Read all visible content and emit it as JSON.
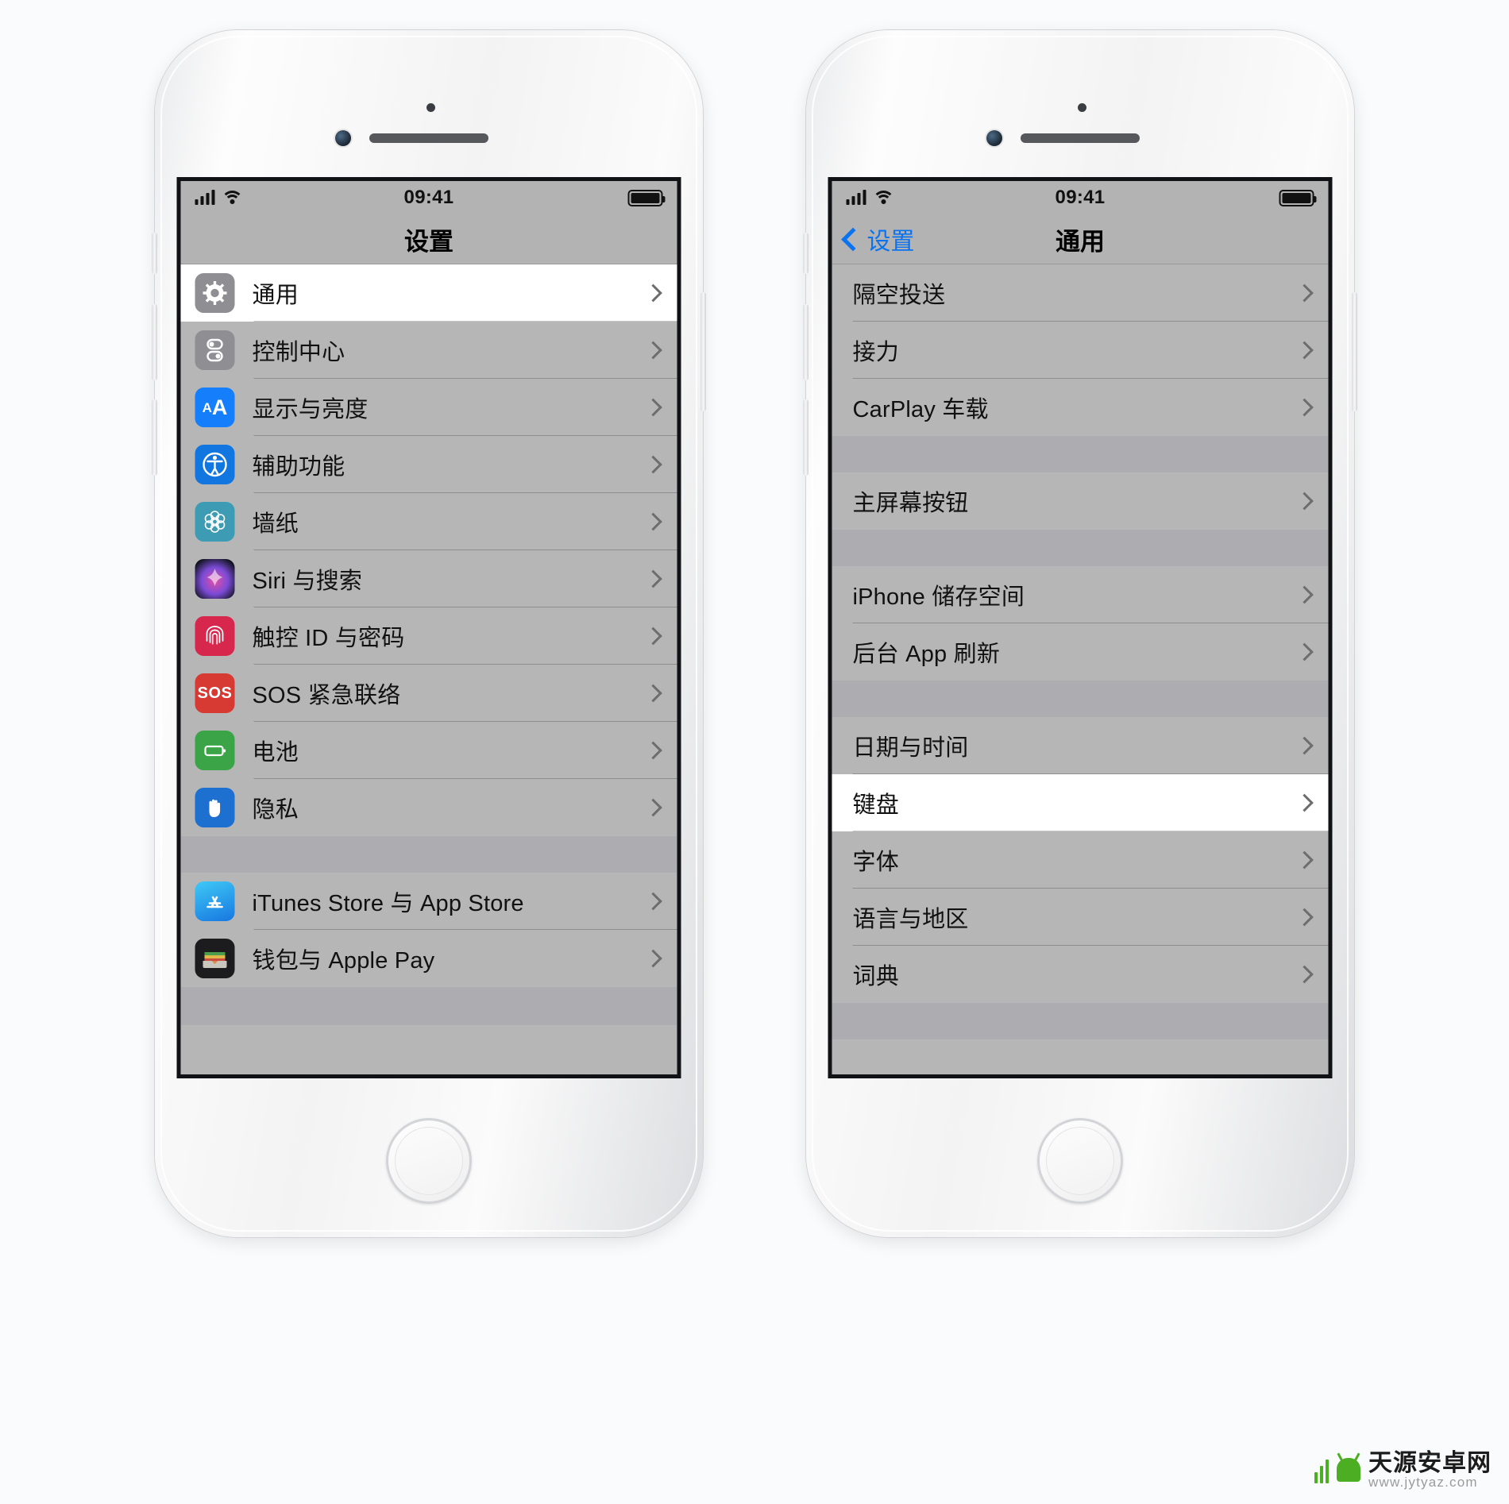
{
  "left_phone": {
    "status_bar": {
      "signal_icon": "cellular-bars-icon",
      "wifi_icon": "wifi-icon",
      "time": "09:41",
      "battery_icon": "battery-full-icon"
    },
    "nav": {
      "title": "设置"
    },
    "groups": [
      {
        "rows": [
          {
            "icon": "gear-icon",
            "label": "通用",
            "selected": true
          },
          {
            "icon": "control-center-icon",
            "label": "控制中心",
            "selected": false
          },
          {
            "icon": "display-icon",
            "label": "显示与亮度",
            "selected": false
          },
          {
            "icon": "accessibility-icon",
            "label": "辅助功能",
            "selected": false
          },
          {
            "icon": "wallpaper-icon",
            "label": "墙纸",
            "selected": false
          },
          {
            "icon": "siri-icon",
            "label": "Siri 与搜索",
            "selected": false
          },
          {
            "icon": "touch-id-icon",
            "label": "触控 ID 与密码",
            "selected": false
          },
          {
            "icon": "sos-icon",
            "label": "SOS 紧急联络",
            "selected": false
          },
          {
            "icon": "battery-icon",
            "label": "电池",
            "selected": false
          },
          {
            "icon": "privacy-hand-icon",
            "label": "隐私",
            "selected": false
          }
        ]
      },
      {
        "rows": [
          {
            "icon": "app-store-icon",
            "label": "iTunes Store 与 App Store",
            "selected": false
          },
          {
            "icon": "wallet-icon",
            "label": "钱包与 Apple Pay",
            "selected": false
          }
        ]
      }
    ]
  },
  "right_phone": {
    "status_bar": {
      "signal_icon": "cellular-bars-icon",
      "wifi_icon": "wifi-icon",
      "time": "09:41",
      "battery_icon": "battery-full-icon"
    },
    "nav": {
      "back_label": "设置",
      "back_icon": "chevron-left-icon",
      "title": "通用"
    },
    "groups": [
      {
        "rows": [
          {
            "label": "隔空投送",
            "selected": false
          },
          {
            "label": "接力",
            "selected": false
          },
          {
            "label": "CarPlay 车载",
            "selected": false
          }
        ]
      },
      {
        "rows": [
          {
            "label": "主屏幕按钮",
            "selected": false
          }
        ]
      },
      {
        "rows": [
          {
            "label": "iPhone 储存空间",
            "selected": false
          },
          {
            "label": "后台 App 刷新",
            "selected": false
          }
        ]
      },
      {
        "rows": [
          {
            "label": "日期与时间",
            "selected": false
          },
          {
            "label": "键盘",
            "selected": true
          },
          {
            "label": "字体",
            "selected": false
          },
          {
            "label": "语言与地区",
            "selected": false
          },
          {
            "label": "词典",
            "selected": false
          }
        ]
      }
    ]
  },
  "watermark": {
    "name": "天源安卓网",
    "url": "www.jytyaz.com",
    "logo_icon": "android-robot-icon"
  },
  "colors": {
    "accent_blue": "#0a73ef",
    "screen_bg": "#b6b6b6",
    "group_gap": "#adadb1",
    "selected_row": "#ffffff",
    "status_bar_bg": "#b3b3b3"
  }
}
